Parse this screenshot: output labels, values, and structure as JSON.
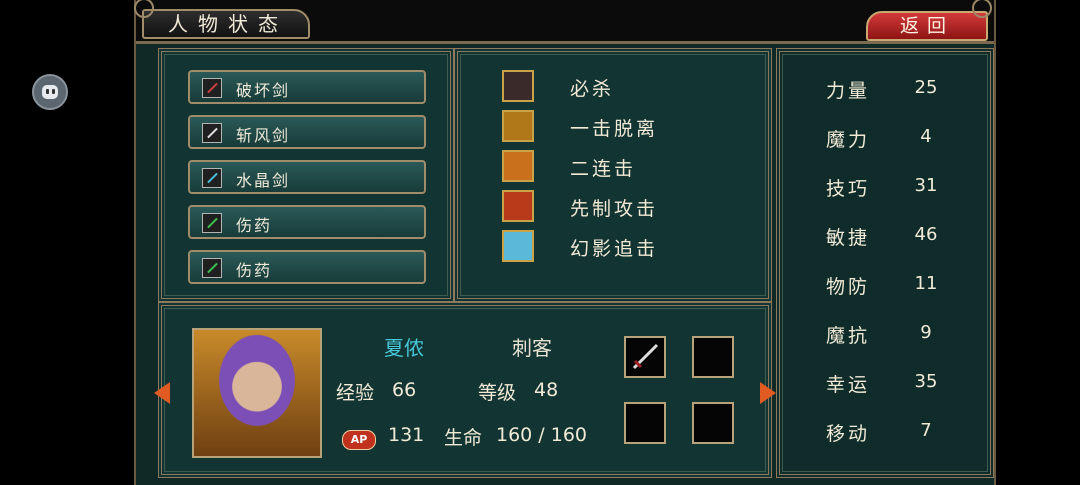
{
  "header": {
    "title": "人物状态",
    "return_label": "返回"
  },
  "items": [
    {
      "label": "破坏剑",
      "icon": "sword-icon",
      "color": "#d04040"
    },
    {
      "label": "斩风剑",
      "icon": "sword-icon",
      "color": "#e0e0e0"
    },
    {
      "label": "水晶剑",
      "icon": "sword-icon",
      "color": "#46c0e0"
    },
    {
      "label": "伤药",
      "icon": "potion-icon",
      "color": "#3cc050"
    },
    {
      "label": "伤药",
      "icon": "potion-icon",
      "color": "#3cc050"
    }
  ],
  "skills": [
    {
      "label": "必杀",
      "icon": "demon-mask-icon",
      "color": "#3a2a2a"
    },
    {
      "label": "一击脱离",
      "icon": "beast-strike-icon",
      "color": "#b07818"
    },
    {
      "label": "二连击",
      "icon": "twin-blade-icon",
      "color": "#c8701c"
    },
    {
      "label": "先制攻击",
      "icon": "red-demon-icon",
      "color": "#b83a1a"
    },
    {
      "label": "幻影追击",
      "icon": "phantom-slash-icon",
      "color": "#5ab8d8"
    }
  ],
  "stats": [
    {
      "name": "力量",
      "value": "25"
    },
    {
      "name": "魔力",
      "value": "4"
    },
    {
      "name": "技巧",
      "value": "31"
    },
    {
      "name": "敏捷",
      "value": "46"
    },
    {
      "name": "物防",
      "value": "11"
    },
    {
      "name": "魔抗",
      "value": "9"
    },
    {
      "name": "幸运",
      "value": "35"
    },
    {
      "name": "移动",
      "value": "7"
    }
  ],
  "character": {
    "name": "夏侬",
    "class": "刺客",
    "exp_label": "经验",
    "exp_value": "66",
    "level_label": "等级",
    "level_value": "48",
    "ap_badge": "AP",
    "ap_value": "131",
    "hp_label": "生命",
    "hp_value": "160 / 160",
    "name_color": "#46c8d8"
  },
  "equipment_slots": [
    {
      "icon": "dagger-icon",
      "filled": true
    },
    {
      "icon": "",
      "filled": false
    },
    {
      "icon": "",
      "filled": false
    },
    {
      "icon": "",
      "filled": false
    }
  ]
}
